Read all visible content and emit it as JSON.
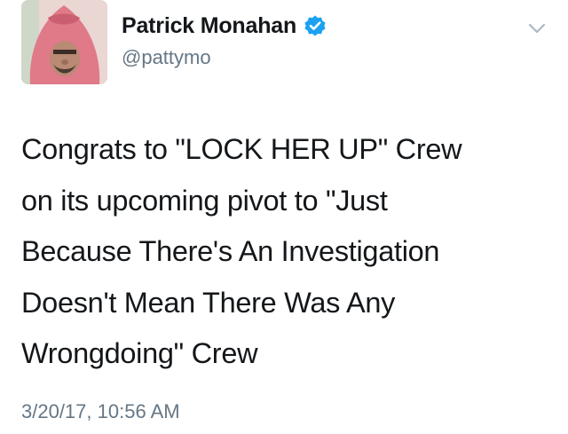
{
  "tweet": {
    "author": {
      "display_name": "Patrick Monahan",
      "handle": "@pattymo",
      "verified": true
    },
    "text": "Congrats to \"LOCK HER UP\" Crew\non its upcoming pivot to \"Just\nBecause There's An Investigation\nDoesn't Mean There Was Any\nWrongdoing\" Crew",
    "timestamp": "3/20/17, 10:56 AM"
  },
  "icons": {
    "verified": "verified-badge-icon",
    "menu": "chevron-down-icon"
  },
  "colors": {
    "verified_blue": "#1da1f2",
    "secondary_text": "#657786",
    "primary_text": "#14171a",
    "chevron": "#aab8c2"
  }
}
